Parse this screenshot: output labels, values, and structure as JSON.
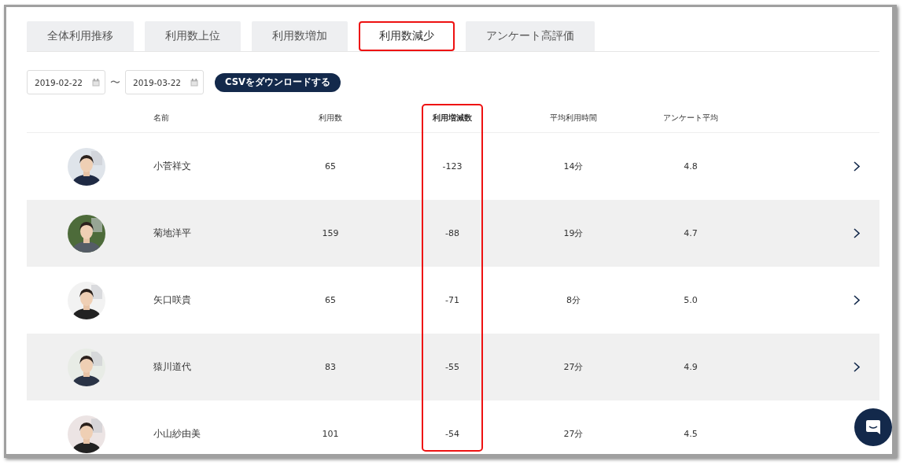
{
  "tabs": [
    {
      "label": "全体利用推移",
      "selected": false,
      "highlighted": false
    },
    {
      "label": "利用数上位",
      "selected": false,
      "highlighted": false
    },
    {
      "label": "利用数増加",
      "selected": false,
      "highlighted": false
    },
    {
      "label": "利用数減少",
      "selected": true,
      "highlighted": true
    },
    {
      "label": "アンケート高評価",
      "selected": false,
      "highlighted": false
    }
  ],
  "filters": {
    "start_date": "2019-02-22",
    "separator": "〜",
    "end_date": "2019-03-22",
    "csv_button": "CSVをダウンロードする"
  },
  "table": {
    "columns": [
      {
        "label": "名前",
        "highlighted": false
      },
      {
        "label": "利用数",
        "highlighted": false
      },
      {
        "label": "利用増減数",
        "highlighted": true
      },
      {
        "label": "平均利用時間",
        "highlighted": false
      },
      {
        "label": "アンケート平均",
        "highlighted": false
      }
    ],
    "rows": [
      {
        "name": "小菅祥文",
        "count": "65",
        "change": "-123",
        "avg_time": "14分",
        "survey_avg": "4.8"
      },
      {
        "name": "菊地洋平",
        "count": "159",
        "change": "-88",
        "avg_time": "19分",
        "survey_avg": "4.7"
      },
      {
        "name": "矢口咲貴",
        "count": "65",
        "change": "-71",
        "avg_time": "8分",
        "survey_avg": "5.0"
      },
      {
        "name": "猿川道代",
        "count": "83",
        "change": "-55",
        "avg_time": "27分",
        "survey_avg": "4.9"
      },
      {
        "name": "小山紗由美",
        "count": "101",
        "change": "-54",
        "avg_time": "27分",
        "survey_avg": "4.5"
      }
    ]
  }
}
